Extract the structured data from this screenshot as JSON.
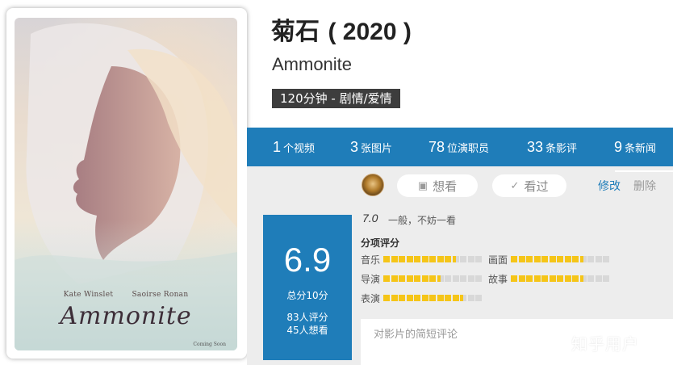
{
  "movie": {
    "title_cn": "菊石",
    "year_text": "( 2020 )",
    "title_en": "Ammonite",
    "tag": "120分钟 - 剧情/爱情"
  },
  "poster": {
    "actors": [
      "Kate Winslet",
      "Saoirse Ronan"
    ],
    "title": "Ammonite",
    "footer": "Coming Soon"
  },
  "stats": [
    {
      "num": "1",
      "unit": "个视频"
    },
    {
      "num": "3",
      "unit": "张图片"
    },
    {
      "num": "78",
      "unit": "位演职员"
    },
    {
      "num": "33",
      "unit": "条影评"
    },
    {
      "num": "9",
      "unit": "条新闻"
    }
  ],
  "actions": {
    "want_label": "想看",
    "seen_label": "看过",
    "edit_label": "修改",
    "delete_label": "删除"
  },
  "score": {
    "value": "6.9",
    "total_label": "总分10分",
    "raters": "83人评分",
    "wanters": "45人想看"
  },
  "my_rating": {
    "value": "7.0",
    "text": "一般，不妨一看"
  },
  "sub_ratings": {
    "heading": "分项评分",
    "items": [
      {
        "label": "音乐",
        "fraction": 0.7
      },
      {
        "label": "画面",
        "fraction": 0.7
      },
      {
        "label": "导演",
        "fraction": 0.6
      },
      {
        "label": "故事",
        "fraction": 0.7
      },
      {
        "label": "表演",
        "fraction": 0.8
      }
    ]
  },
  "comment": {
    "placeholder": "对影片的简短评论"
  },
  "watermark": "知乎用户",
  "colors": {
    "accent": "#1f7db9",
    "star": "#f5c518",
    "tag_bg": "#3d3d3d"
  }
}
